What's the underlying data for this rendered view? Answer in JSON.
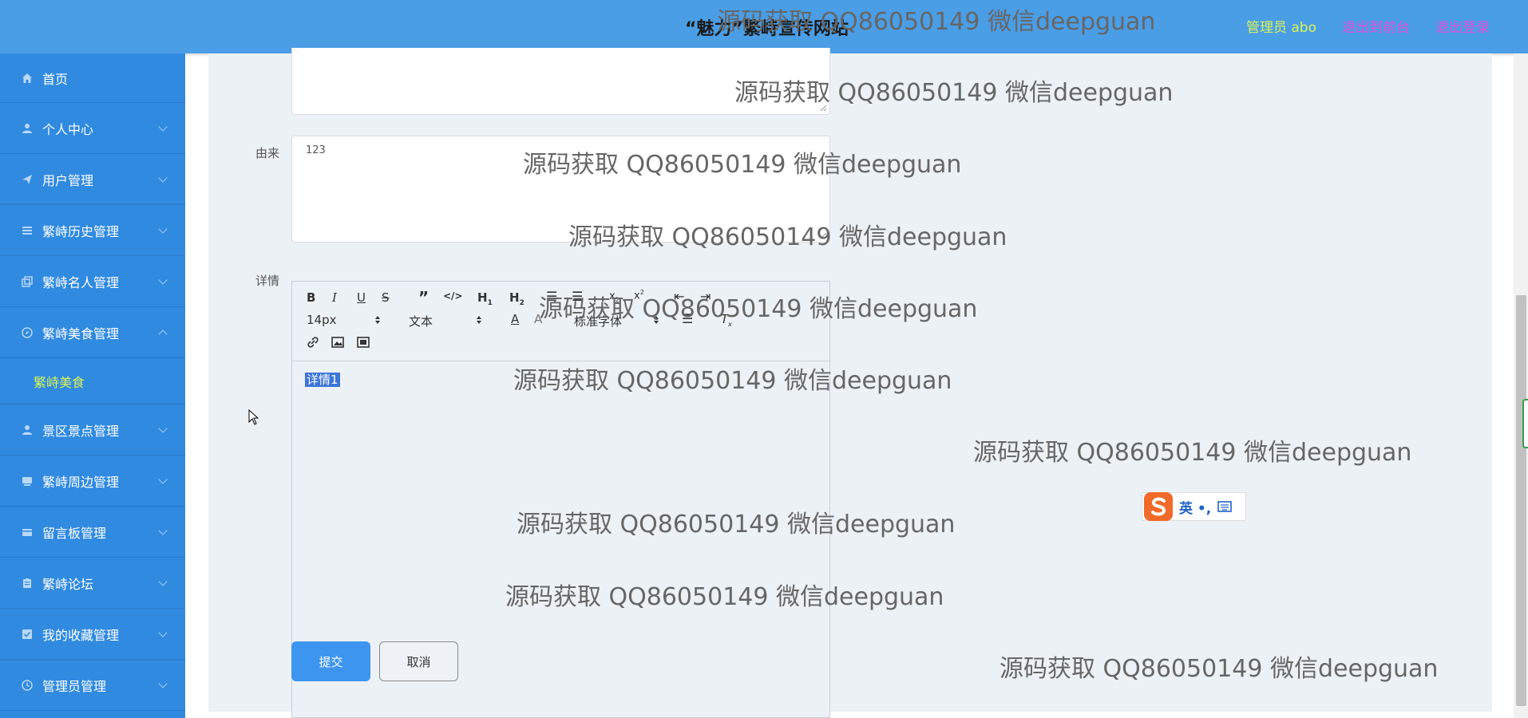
{
  "header": {
    "title": "“魅力”繁峙宣传网站",
    "admin_label": "管理员 abo",
    "to_front": "退出到前台",
    "logout": "退出登录"
  },
  "sidebar": {
    "items": [
      {
        "label": "首页",
        "icon": "home-icon"
      },
      {
        "label": "个人中心",
        "icon": "user-icon"
      },
      {
        "label": "用户管理",
        "icon": "send-icon"
      },
      {
        "label": "繁峙历史管理",
        "icon": "list-icon"
      },
      {
        "label": "繁峙名人管理",
        "icon": "copy-icon"
      },
      {
        "label": "繁峙美食管理",
        "icon": "compass-icon"
      },
      {
        "label": "景区景点管理",
        "icon": "user-icon"
      },
      {
        "label": "繁峙周边管理",
        "icon": "drive-icon"
      },
      {
        "label": "留言板管理",
        "icon": "card-icon"
      },
      {
        "label": "繁峙论坛",
        "icon": "clipboard-icon"
      },
      {
        "label": "我的收藏管理",
        "icon": "check-square-icon"
      },
      {
        "label": "管理员管理",
        "icon": "clock-icon"
      }
    ],
    "submenu": {
      "label": "繁峙美食"
    }
  },
  "form": {
    "origin_label": "由来",
    "origin_value": "123",
    "detail_label": "详情",
    "font_size": "14px",
    "block_format": "文本",
    "font_family": "标准字体",
    "editor_content": "详情1",
    "submit": "提交",
    "cancel": "取消"
  },
  "ime": {
    "text": "英 •,"
  },
  "watermark": "源码获取 QQ86050149 微信deepguan",
  "colors": {
    "header_bg": "#4a9ee6",
    "sidebar_bg": "#2f8ae0",
    "accent_yellow": "#d9f25a",
    "link_pink": "#e24fd8",
    "primary_button": "#3d95ef"
  }
}
